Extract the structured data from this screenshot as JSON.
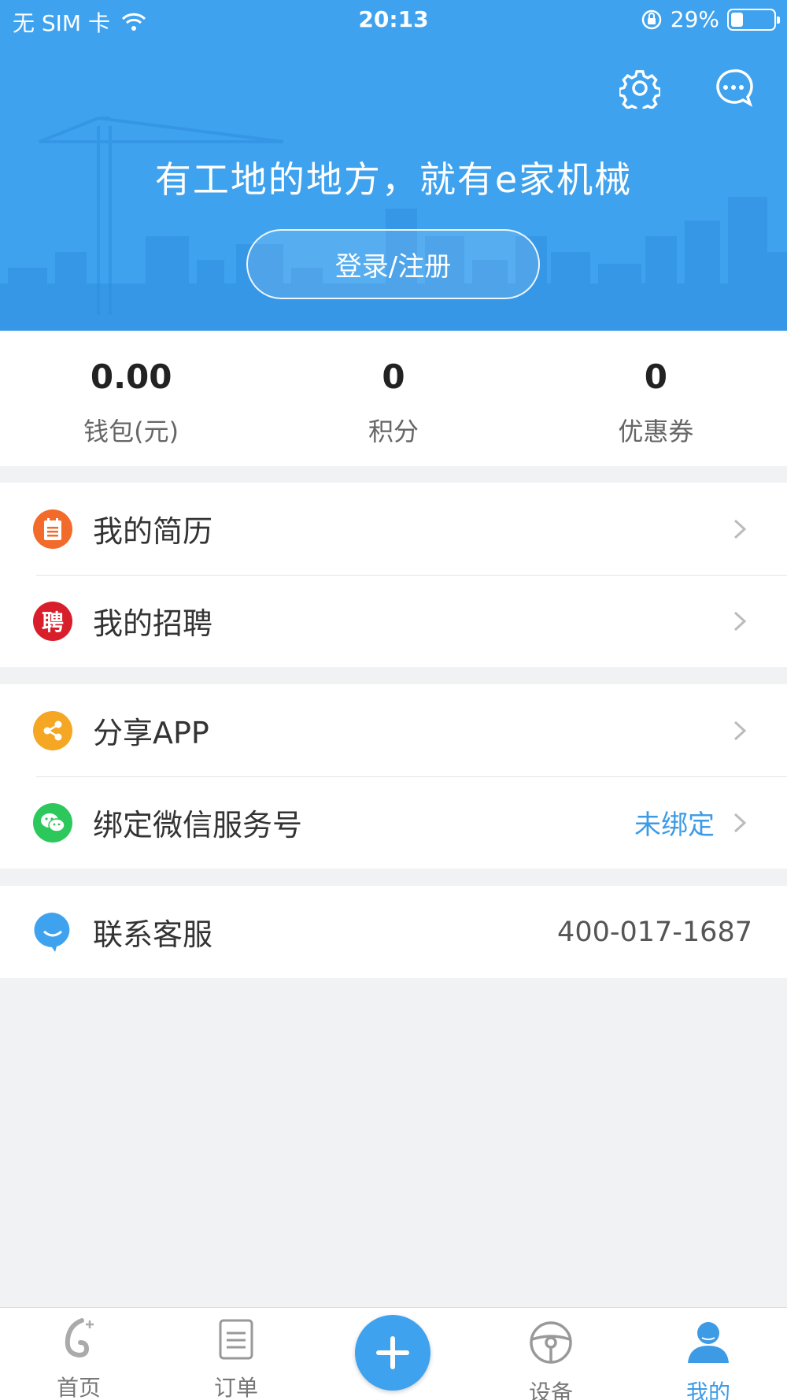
{
  "status_bar": {
    "carrier": "无 SIM 卡",
    "time": "20:13",
    "battery": "29%",
    "battery_level": 0.29
  },
  "header": {
    "slogan": "有工地的地方，就有e家机械",
    "login_label": "登录/注册",
    "icons": [
      "gear-icon",
      "chat-icon"
    ]
  },
  "stats": [
    {
      "value": "0.00",
      "label": "钱包(元)"
    },
    {
      "value": "0",
      "label": "积分"
    },
    {
      "value": "0",
      "label": "优惠券"
    }
  ],
  "menu": {
    "resume": {
      "label": "我的简历",
      "icon": "resume-icon"
    },
    "recruit": {
      "label": "我的招聘",
      "icon_char": "聘"
    },
    "share": {
      "label": "分享APP",
      "icon": "share-icon"
    },
    "wechat": {
      "label": "绑定微信服务号",
      "value": "未绑定",
      "icon": "wechat-icon"
    },
    "service": {
      "label": "联系客服",
      "phone": "400-017-1687",
      "icon": "chat-bubble-icon"
    }
  },
  "tabbar": {
    "home": "首页",
    "orders": "订单",
    "devices": "设备",
    "mine": "我的",
    "active": "mine"
  },
  "colors": {
    "brand_blue": "#3fa2ee",
    "link_blue": "#3d9be6",
    "resume_orange": "#f26b2a",
    "recruit_red": "#d81e2a",
    "share_orange": "#f5a623",
    "wechat_green": "#2dc85b"
  }
}
